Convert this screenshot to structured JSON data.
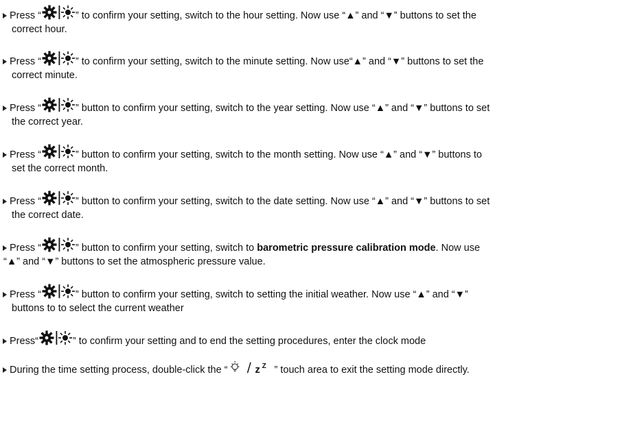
{
  "items": [
    {
      "l1_pre": "Press “",
      "l1_post": "” to confirm your setting, switch to the hour setting. Now use “▲” and “▼” buttons to set the",
      "l2": "correct hour."
    },
    {
      "l1_pre": "Press “",
      "l1_post": "” to confirm your setting, switch to the minute setting. Now use“▲” and “▼” buttons to set the",
      "l2": "correct minute."
    },
    {
      "l1_pre": "Press “",
      "l1_post": "” button to confirm your setting, switch to the year setting. Now use “▲” and “▼” buttons to set",
      "l2": "the correct year."
    },
    {
      "l1_pre": "Press “",
      "l1_post": "” button to confirm your setting, switch to the month setting. Now use “▲” and “▼” buttons to",
      "l2": "set the correct month."
    },
    {
      "l1_pre": "Press “",
      "l1_post": "” button to confirm your setting, switch to the date setting. Now use “▲” and “▼” buttons to set",
      "l2": "the correct date."
    },
    {
      "l1_pre": "Press “",
      "l1_post": "” button to confirm your setting, switch to ",
      "l1_bold": "barometric pressure calibration mode",
      "l1_end": ". Now use",
      "l2": "“▲” and “▼” buttons to set the atmospheric pressure value."
    },
    {
      "l1_pre": "Press “",
      "l1_post": "” button to confirm your setting, switch to setting the initial weather. Now use “▲” and “▼”",
      "l2": "buttons to to select the current weather"
    },
    {
      "l1_pre": "Press“",
      "l1_post": "” to confirm your setting and to end the setting procedures, enter the clock mode"
    },
    {
      "l1_pre": "During the time setting process, double-click the “",
      "l1_post": "” touch area to exit the setting mode directly."
    }
  ],
  "icons": {
    "set_button": "settings-brightness-button-icon",
    "light_snooze": "light-snooze-touch-icon"
  }
}
